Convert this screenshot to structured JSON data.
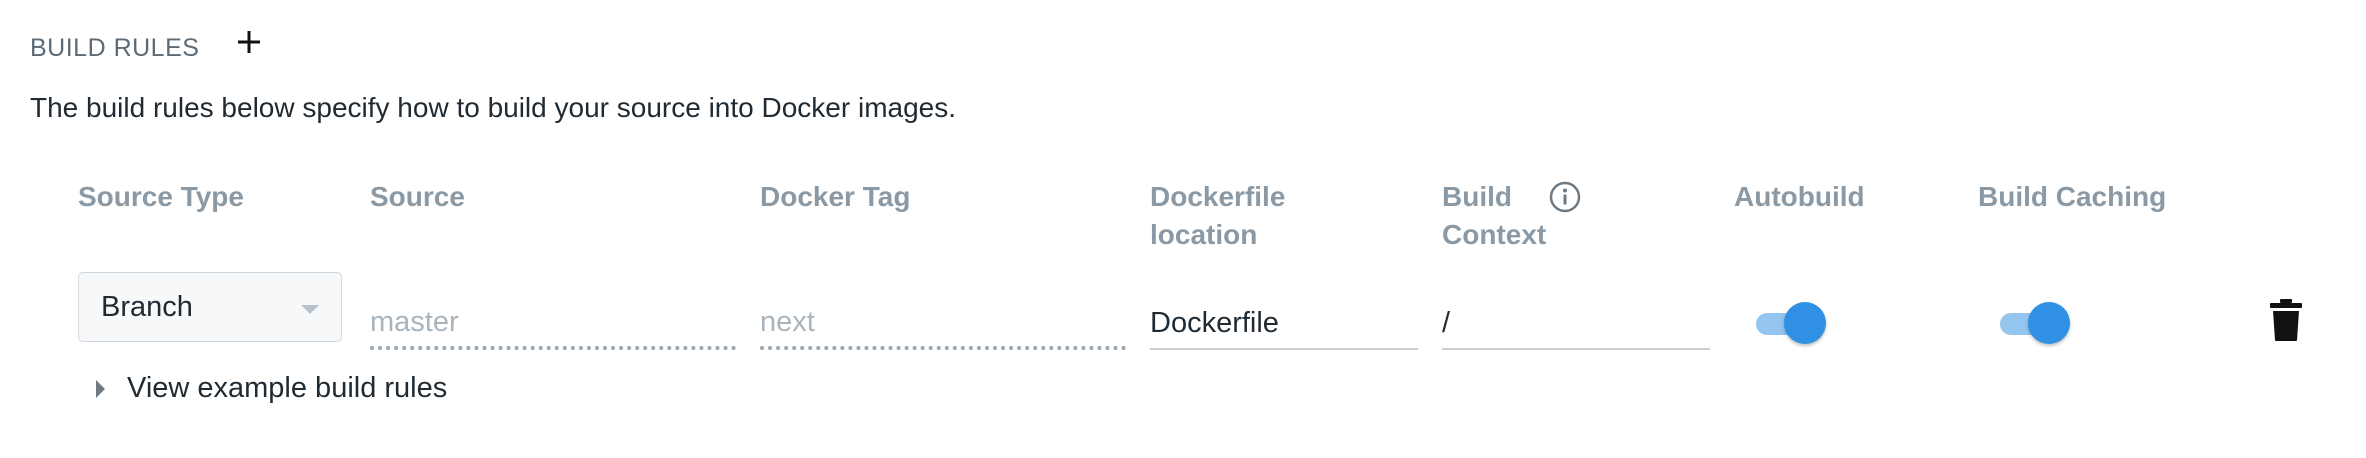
{
  "section": {
    "title": "BUILD RULES",
    "add_icon": "plus-icon",
    "description": "The build rules below specify how to build your source into Docker images."
  },
  "columns": {
    "source_type": "Source Type",
    "source": "Source",
    "docker_tag": "Docker Tag",
    "dockerfile_location_line1": "Dockerfile",
    "dockerfile_location_line2": "location",
    "build_context_line1": "Build",
    "build_context_line2": "Context",
    "autobuild": "Autobuild",
    "build_caching": "Build Caching",
    "info_icon": "info-icon"
  },
  "rule": {
    "source_type": "Branch",
    "source_placeholder": "master",
    "docker_tag_placeholder": "next",
    "dockerfile_location": "Dockerfile",
    "build_context": "/",
    "autobuild_enabled": true,
    "build_caching_enabled": true,
    "delete_icon": "trash-icon"
  },
  "example": {
    "label": "View example build rules"
  },
  "colors": {
    "toggle_on": "#2f90e4",
    "toggle_track": "#93c5ef",
    "header_text": "#8a99a4"
  }
}
